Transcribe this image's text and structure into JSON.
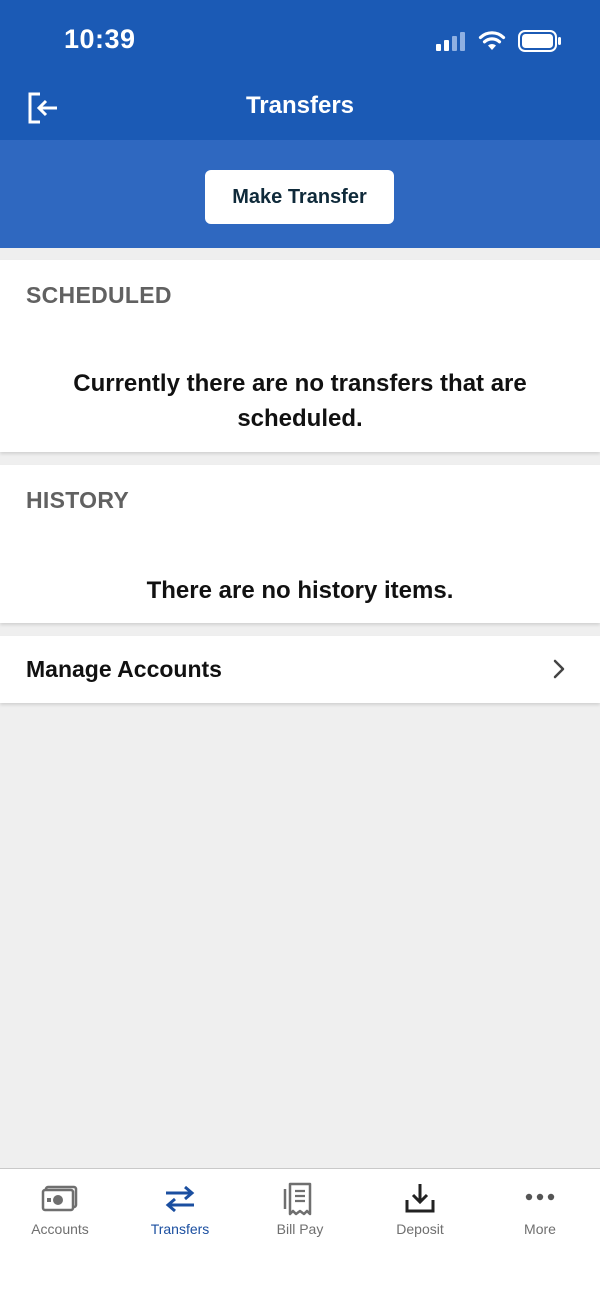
{
  "status_bar": {
    "time": "10:39"
  },
  "nav": {
    "title": "Transfers"
  },
  "actions": {
    "make_transfer_label": "Make Transfer"
  },
  "scheduled": {
    "heading": "SCHEDULED",
    "empty_message": "Currently there are no transfers that are scheduled."
  },
  "history": {
    "heading": "HISTORY",
    "empty_message": "There are no history items."
  },
  "manage_accounts": {
    "label": "Manage Accounts"
  },
  "tabs": [
    {
      "label": "Accounts",
      "icon": "accounts-icon",
      "active": false
    },
    {
      "label": "Transfers",
      "icon": "transfers-icon",
      "active": true
    },
    {
      "label": "Bill Pay",
      "icon": "bill-pay-icon",
      "active": false
    },
    {
      "label": "Deposit",
      "icon": "deposit-icon",
      "active": false
    },
    {
      "label": "More",
      "icon": "more-icon",
      "active": false
    }
  ],
  "colors": {
    "brand": "#1b5ab5",
    "band": "#2f68c0",
    "active_tab": "#1b4fa0",
    "inactive_tab": "#6f6f6f"
  }
}
